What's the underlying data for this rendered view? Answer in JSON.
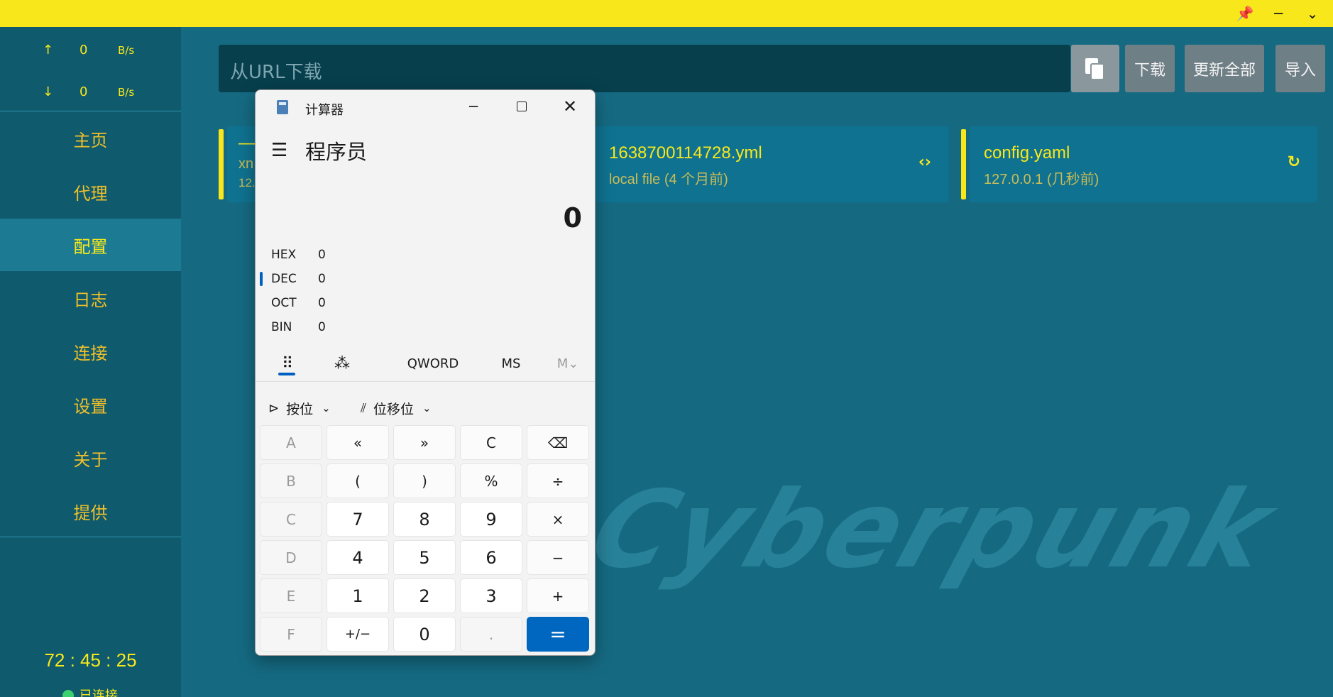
{
  "titlebar": {
    "pin": "📌",
    "minimize": "─",
    "collapse": "⌄"
  },
  "sidebar": {
    "upload": {
      "arrow": "↑",
      "value": "0",
      "unit": "B/s"
    },
    "download": {
      "arrow": "↓",
      "value": "0",
      "unit": "B/s"
    },
    "items": [
      "主页",
      "代理",
      "配置",
      "日志",
      "连接",
      "设置",
      "关于",
      "提供"
    ],
    "active_index": 2,
    "timer": "72 : 45 : 25",
    "status": "已连接"
  },
  "toolbar": {
    "url_placeholder": "从URL下载",
    "download": "下载",
    "update_all": "更新全部",
    "import": "导入"
  },
  "profiles": [
    {
      "title": "—",
      "sub": "xn",
      "sub2": "12."
    },
    {
      "title": "1638700114728.yml",
      "sub": "local file (4 个月前)",
      "icon": "‹›"
    },
    {
      "title": "config.yaml",
      "sub": "127.0.0.1 (几秒前)",
      "icon": "↻"
    }
  ],
  "logo_text": "Cyberpunk",
  "calculator": {
    "window_title": "计算器",
    "mode": "程序员",
    "display": "0",
    "bases": [
      {
        "name": "HEX",
        "value": "0"
      },
      {
        "name": "DEC",
        "value": "0"
      },
      {
        "name": "OCT",
        "value": "0"
      },
      {
        "name": "BIN",
        "value": "0"
      }
    ],
    "word_size": "QWORD",
    "ms": "MS",
    "mem": "M⌄",
    "bitwise": "按位",
    "bitshift": "位移位",
    "keys": [
      [
        "A",
        "«",
        "»",
        "C",
        "⌫"
      ],
      [
        "B",
        "(",
        ")",
        "%",
        "÷"
      ],
      [
        "C",
        "7",
        "8",
        "9",
        "×"
      ],
      [
        "D",
        "4",
        "5",
        "6",
        "−"
      ],
      [
        "E",
        "1",
        "2",
        "3",
        "+"
      ],
      [
        "F",
        "+/−",
        "0",
        ".",
        "="
      ]
    ]
  }
}
